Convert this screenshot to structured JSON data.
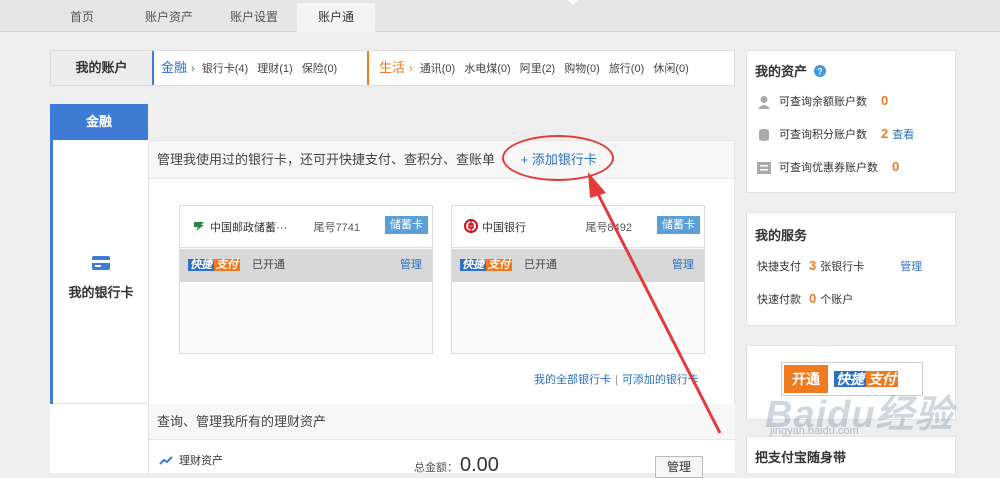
{
  "nav": {
    "tabs": [
      {
        "label": "首页"
      },
      {
        "label": "账户资产"
      },
      {
        "label": "账户设置"
      },
      {
        "label": "账户通"
      }
    ]
  },
  "account_bar": {
    "title": "我的账户",
    "finance": {
      "label": "金融",
      "items": [
        "银行卡(4)",
        "理财(1)",
        "保险(0)"
      ]
    },
    "life": {
      "label": "生活",
      "items": [
        "通讯(0)",
        "水电煤(0)",
        "阿里(2)",
        "购物(0)",
        "旅行(0)",
        "休闲(0)"
      ]
    }
  },
  "finance_tab": "金融",
  "card_section": {
    "side_label": "我的银行卡",
    "description": "管理我使用过的银行卡，还可开快捷支付、查积分、查账单",
    "add_link": "+ 添加银行卡",
    "cards": [
      {
        "bank": "中国邮政储蓄···",
        "tail": "尾号7741",
        "type": "储蓄卡",
        "quickpay_a": "快捷",
        "quickpay_b": "支付",
        "status": "已开通",
        "manage": "管理"
      },
      {
        "bank": "中国银行",
        "tail": "尾号8492",
        "type": "储蓄卡",
        "quickpay_a": "快捷",
        "quickpay_b": "支付",
        "status": "已开通",
        "manage": "管理"
      }
    ],
    "link_all": "我的全部银行卡",
    "link_addable": "可添加的银行卡"
  },
  "wealth_section": {
    "title": "查询、管理我所有的理财资产",
    "item": "理财资产",
    "total_label": "总金额：",
    "total_value": "0.00",
    "manage": "管理"
  },
  "assets": {
    "title": "我的资产",
    "rows": [
      {
        "label": "可查询余额账户数",
        "value": "0"
      },
      {
        "label": "可查询积分账户数",
        "value": "2",
        "link": "查看"
      },
      {
        "label": "可查询优惠券账户数",
        "value": "0"
      }
    ]
  },
  "services": {
    "title": "我的服务",
    "quickpay": {
      "label": "快捷支付",
      "value": "3",
      "unit": "张银行卡",
      "link": "管理"
    },
    "fastpay": {
      "label": "快速付款",
      "value": "0",
      "unit": "个账户"
    }
  },
  "promo": {
    "open": "开通",
    "brand_a": "快捷",
    "brand_b": "支付"
  },
  "mobile": {
    "title": "把支付宝随身带"
  },
  "watermark": {
    "main": "Baidu经验",
    "sub": "jingyan.baidu.com"
  },
  "colors": {
    "blue": "#3d7bd4",
    "orange": "#f07a20",
    "annotation": "#e33b3b"
  }
}
